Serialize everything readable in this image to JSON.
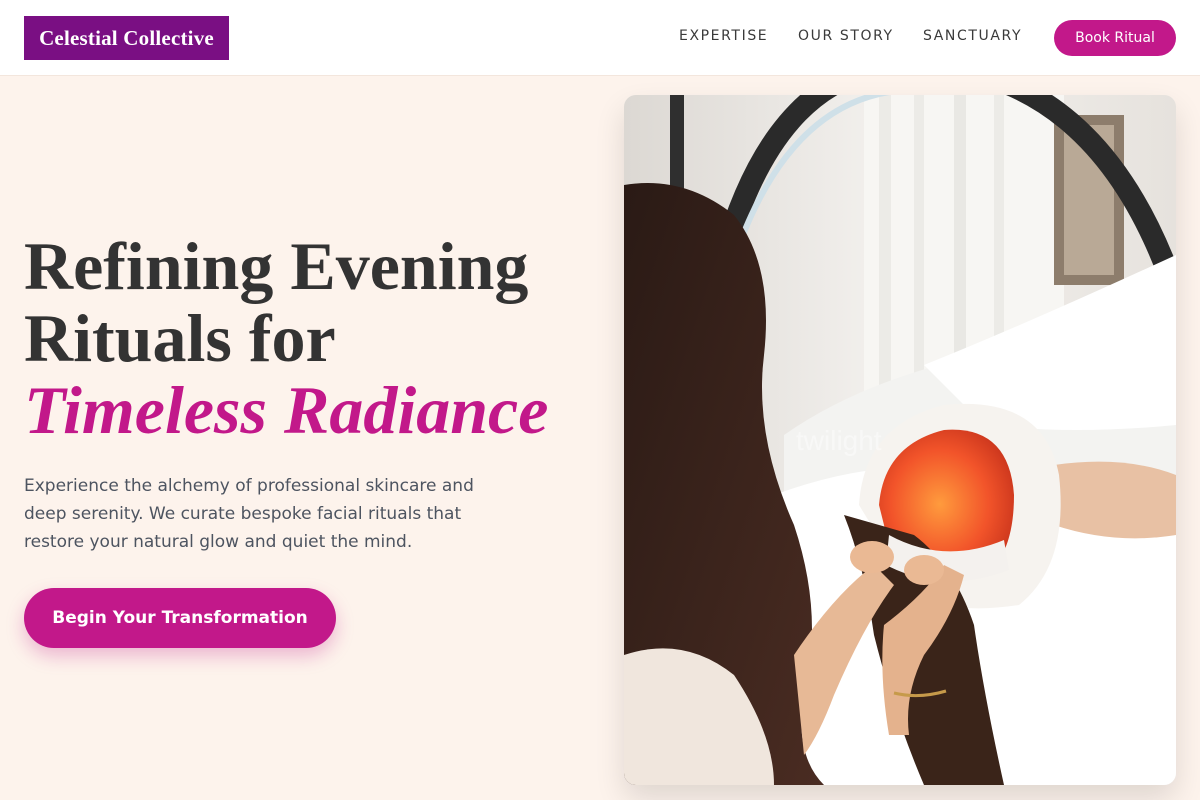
{
  "header": {
    "logo": "Celestial Collective",
    "nav": [
      "EXPERTISE",
      "OUR STORY",
      "SANCTUARY"
    ],
    "book_label": "Book Ritual"
  },
  "hero": {
    "title_line1": "Refining Evening",
    "title_line2": "Rituals for",
    "title_accent": "Timeless Radiance",
    "description": "Experience the alchemy of professional skincare and deep serenity. We curate bespoke facial rituals that restore your natural glow and quiet the mind.",
    "cta_label": "Begin Your Transformation"
  },
  "colors": {
    "brand": "#7a0f83",
    "accent": "#c2188a",
    "background": "#fdf3ec"
  }
}
